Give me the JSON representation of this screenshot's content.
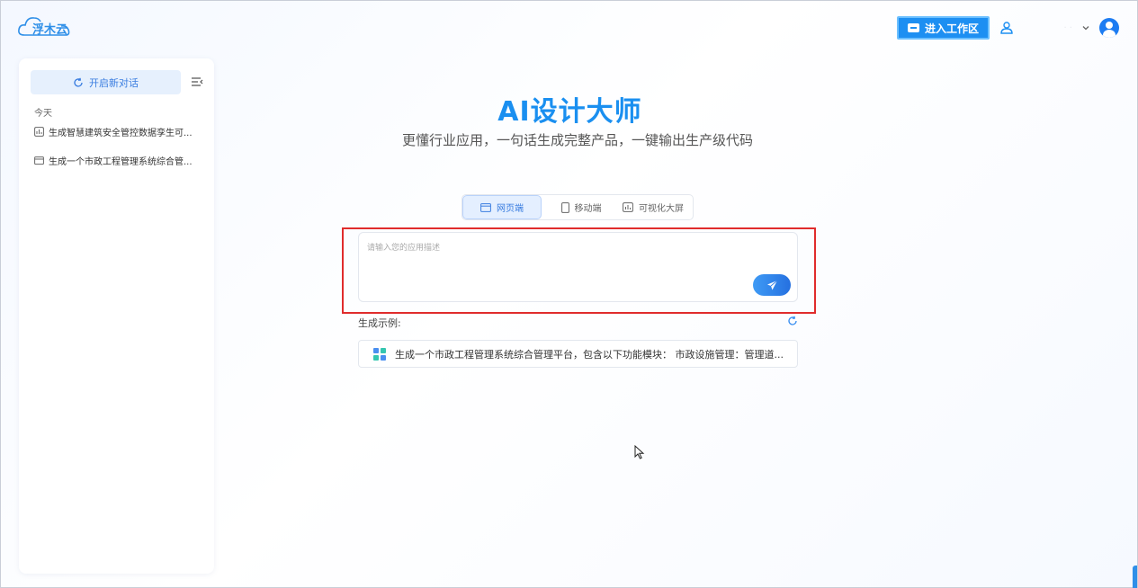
{
  "brand": {
    "name": "浮木云"
  },
  "topbar": {
    "workspace_label": "进入工作区",
    "username": "·  ·"
  },
  "sidebar": {
    "new_chat_label": "开启新对话",
    "section_today": "今天",
    "history": [
      {
        "label": "生成智慧建筑安全管控数据孪生可...",
        "icon": "dashboard-icon"
      },
      {
        "label": "生成一个市政工程管理系统综合管...",
        "icon": "window-icon"
      }
    ]
  },
  "hero": {
    "title": "AI设计大师",
    "subtitle": "更懂行业应用，一句话生成完整产品，一键输出生产级代码"
  },
  "tabs": [
    {
      "label": "网页端",
      "active": true
    },
    {
      "label": "移动端",
      "active": false
    },
    {
      "label": "可视化大屏",
      "active": false
    }
  ],
  "input": {
    "placeholder": "请输入您的应用描述",
    "value": ""
  },
  "examples": {
    "label": "生成示例:",
    "items": [
      {
        "text": "生成一个市政工程管理系统综合管理平台，包含以下功能模块： 市政设施管理：管理道..."
      }
    ]
  },
  "colors": {
    "accent": "#1d8ff2",
    "highlight": "#e02c2c"
  }
}
